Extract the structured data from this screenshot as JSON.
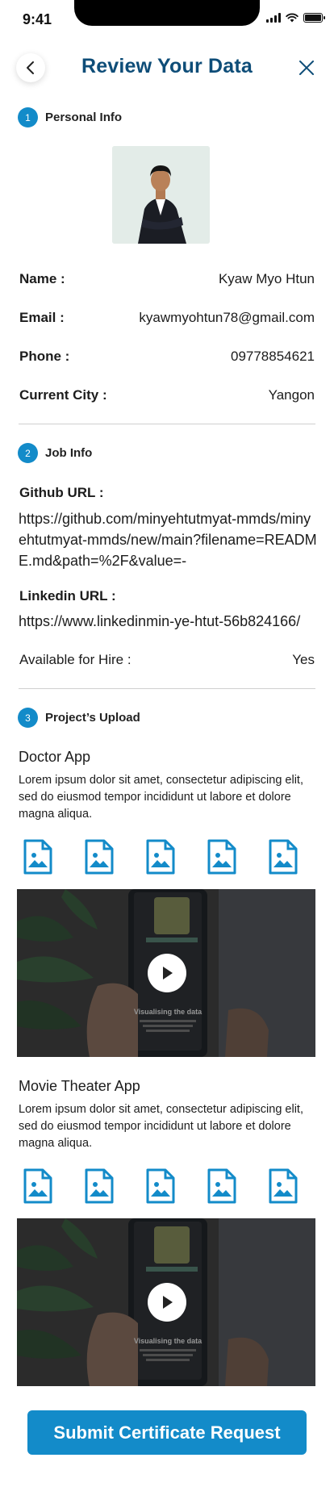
{
  "status_bar": {
    "time": "9:41"
  },
  "header": {
    "title": "Review Your Data"
  },
  "personal": {
    "step": "1",
    "title": "Personal Info",
    "rows": [
      {
        "label": "Name :",
        "value": "Kyaw Myo Htun"
      },
      {
        "label": "Email :",
        "value": "kyawmyohtun78@gmail.com"
      },
      {
        "label": "Phone :",
        "value": "09778854621"
      },
      {
        "label": "Current City :",
        "value": "Yangon"
      }
    ]
  },
  "job": {
    "step": "2",
    "title": "Job Info",
    "github_label": "Github URL :",
    "github_url": "https://github.com/minyehtutmyat-mmds/minyehtutmyat-mmds/new/main?filename=README.md&path=%2F&value=-",
    "linkedin_label": "Linkedin URL :",
    "linkedin_url": "https://www.linkedinmin-ye-htut-56b824166/",
    "hire_label": "Available for Hire :",
    "hire_value": "Yes"
  },
  "projects": {
    "step": "3",
    "title": "Project’s Upload",
    "items": [
      {
        "name": "Doctor App",
        "description": "Lorem ipsum dolor sit amet, consectetur adipiscing elit, sed do eiusmod tempor incididunt ut labore et dolore magna aliqua.",
        "video_caption": "Visualising the data"
      },
      {
        "name": "Movie Theater App",
        "description": "Lorem ipsum dolor sit amet, consectetur adipiscing elit, sed do eiusmod tempor incididunt ut labore et dolore magna aliqua.",
        "video_caption": "Visualising the data"
      }
    ]
  },
  "submit_label": "Submit Certificate Request",
  "colors": {
    "primary": "#138bc9",
    "title": "#0e4d78"
  }
}
